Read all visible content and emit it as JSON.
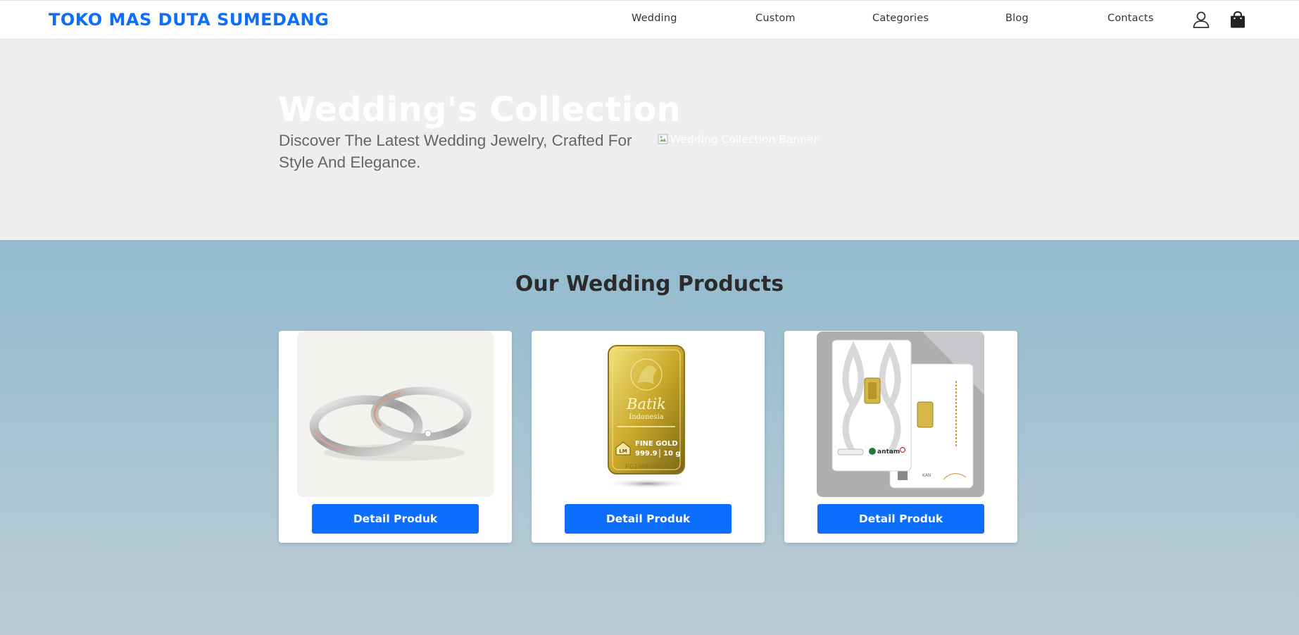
{
  "navbar": {
    "brand": "TOKO MAS DUTA SUMEDANG",
    "links": [
      "Wedding",
      "Custom",
      "Categories",
      "Blog",
      "Contacts"
    ],
    "icons": [
      "user-icon",
      "shopping-bag-icon"
    ]
  },
  "hero": {
    "title": "Wedding's Collection",
    "subtitle": "Discover The Latest Wedding Jewelry, Crafted For Style And Elegance.",
    "banner_alt": "Wedding Collection Banner"
  },
  "products": {
    "title": "Our Wedding Products",
    "cards": [
      {
        "image": "wedding-rings-image",
        "button_label": "Detail Produk"
      },
      {
        "image": "gold-bar-image",
        "button_label": "Detail Produk",
        "image_text": {
          "line1": "Batik",
          "line2": "Indonesia",
          "grade": "FINE GOLD",
          "purity": "999.9",
          "weight": "10 g",
          "serial": "FG10HK0001"
        }
      },
      {
        "image": "gold-certificate-pack-image",
        "button_label": "Detail Produk",
        "image_text": {
          "logo": "antam"
        }
      }
    ]
  },
  "colors": {
    "brand": "#0d6efd",
    "hero_bg": "#eeeeee",
    "products_bg_top": "#92bbd0",
    "products_bg_bottom": "#bcccd4"
  }
}
